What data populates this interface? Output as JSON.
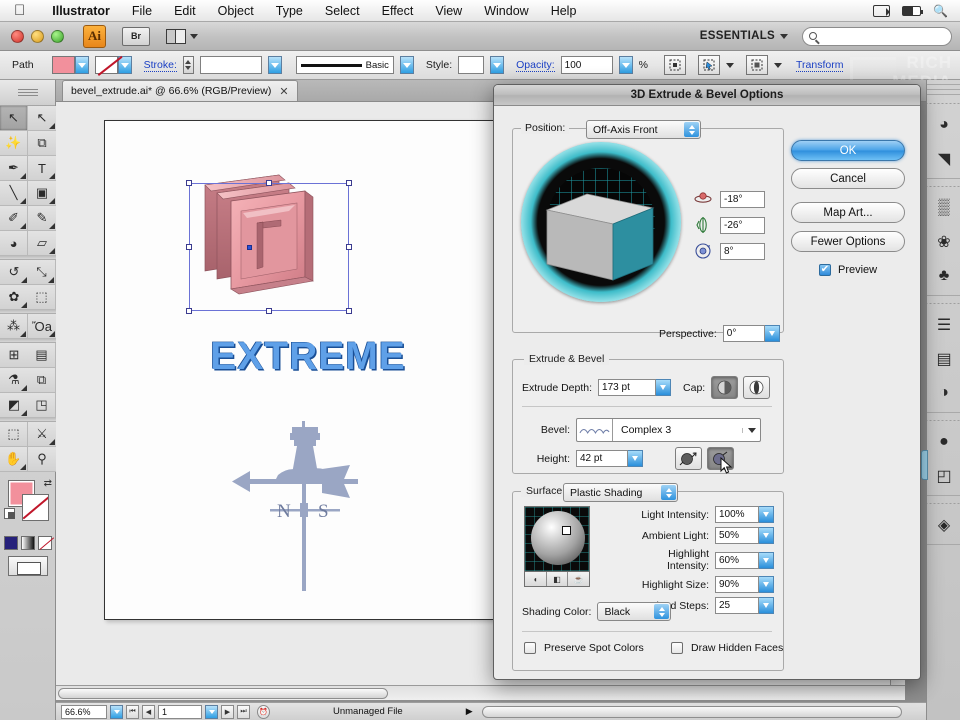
{
  "macmenu": {
    "apple": "apple-logo",
    "items": [
      "Illustrator",
      "File",
      "Edit",
      "Object",
      "Type",
      "Select",
      "Effect",
      "View",
      "Window",
      "Help"
    ]
  },
  "appbar": {
    "ai_badge": "Ai",
    "bridge_label": "Br",
    "workspace": "ESSENTIALS",
    "search_placeholder": ""
  },
  "controlbar": {
    "object_label": "Path",
    "stroke_label": "Stroke:",
    "stroke_weight": "",
    "brush_name": "Basic",
    "style_label": "Style:",
    "opacity_label": "Opacity:",
    "opacity_value": "100",
    "percent": "%",
    "transform_label": "Transform"
  },
  "document": {
    "tab_title": "bevel_extrude.ai* @ 66.6% (RGB/Preview)",
    "close_glyph": "✕"
  },
  "artwork": {
    "wordmark": "EXTREME",
    "vane_north": "N",
    "vane_south": "S",
    "fill_color": "#f2909c",
    "wordmark_color": "#5fa0e8"
  },
  "statusbar": {
    "zoom": "66.6%",
    "page": "1",
    "status_text": "Unmanaged File"
  },
  "watermark": {
    "line1": "RICH",
    "line2": "MEDIA",
    "line3": "INSTITUTE"
  },
  "tools": [
    {
      "name": "selection-tool",
      "glyph": "↖",
      "selected": true,
      "has_flyout": false
    },
    {
      "name": "direct-selection-tool",
      "glyph": "↖",
      "selected": false,
      "has_flyout": true
    },
    {
      "name": "magic-wand-tool",
      "glyph": "✨",
      "selected": false,
      "has_flyout": false
    },
    {
      "name": "lasso-tool",
      "glyph": "⧉",
      "selected": false,
      "has_flyout": false
    },
    {
      "name": "pen-tool",
      "glyph": "✒",
      "selected": false,
      "has_flyout": true
    },
    {
      "name": "type-tool",
      "glyph": "T",
      "selected": false,
      "has_flyout": true
    },
    {
      "name": "line-segment-tool",
      "glyph": "╲",
      "selected": false,
      "has_flyout": true
    },
    {
      "name": "rectangle-tool",
      "glyph": "▣",
      "selected": false,
      "has_flyout": true
    },
    {
      "name": "paintbrush-tool",
      "glyph": "✐",
      "selected": false,
      "has_flyout": true
    },
    {
      "name": "pencil-tool",
      "glyph": "✎",
      "selected": false,
      "has_flyout": true
    },
    {
      "name": "blob-brush-tool",
      "glyph": "◕",
      "selected": false,
      "has_flyout": false
    },
    {
      "name": "eraser-tool",
      "glyph": "▱",
      "selected": false,
      "has_flyout": true
    },
    {
      "name": "rotate-tool",
      "glyph": "↺",
      "selected": false,
      "has_flyout": true
    },
    {
      "name": "scale-tool",
      "glyph": "⤡",
      "selected": false,
      "has_flyout": true
    },
    {
      "name": "warp-tool",
      "glyph": "✿",
      "selected": false,
      "has_flyout": true
    },
    {
      "name": "free-transform-tool",
      "glyph": "⬚",
      "selected": false,
      "has_flyout": false
    },
    {
      "name": "symbol-sprayer-tool",
      "glyph": "⁂",
      "selected": false,
      "has_flyout": true
    },
    {
      "name": "column-graph-tool",
      "glyph": "Ὄa",
      "selected": false,
      "has_flyout": true
    },
    {
      "name": "mesh-tool",
      "glyph": "⊞",
      "selected": false,
      "has_flyout": false
    },
    {
      "name": "gradient-tool",
      "glyph": "▤",
      "selected": false,
      "has_flyout": false
    },
    {
      "name": "eyedropper-tool",
      "glyph": "⚗",
      "selected": false,
      "has_flyout": true
    },
    {
      "name": "blend-tool",
      "glyph": "⧉",
      "selected": false,
      "has_flyout": false
    },
    {
      "name": "live-paint-bucket-tool",
      "glyph": "◩",
      "selected": false,
      "has_flyout": true
    },
    {
      "name": "live-paint-selection-tool",
      "glyph": "◳",
      "selected": false,
      "has_flyout": false
    },
    {
      "name": "artboard-tool",
      "glyph": "⬚",
      "selected": false,
      "has_flyout": false
    },
    {
      "name": "slice-tool",
      "glyph": "⚔",
      "selected": false,
      "has_flyout": true
    },
    {
      "name": "hand-tool",
      "glyph": "✋",
      "selected": false,
      "has_flyout": true
    },
    {
      "name": "zoom-tool",
      "glyph": "⚲",
      "selected": false,
      "has_flyout": false
    }
  ],
  "right_dock": [
    {
      "name": "color-panel-icon",
      "glyph": "◕"
    },
    {
      "name": "color-guide-panel-icon",
      "glyph": "◥"
    },
    {
      "name": "swatches-panel-icon",
      "glyph": "▒"
    },
    {
      "name": "brushes-panel-icon",
      "glyph": "❀"
    },
    {
      "name": "symbols-panel-icon",
      "glyph": "♣"
    },
    {
      "name": "stroke-panel-icon",
      "glyph": "☰"
    },
    {
      "name": "gradient-panel-icon",
      "glyph": "▤"
    },
    {
      "name": "transparency-panel-icon",
      "glyph": "◑"
    },
    {
      "name": "appearance-panel-icon",
      "glyph": "●"
    },
    {
      "name": "graphic-styles-panel-icon",
      "glyph": "◰"
    },
    {
      "name": "layers-panel-icon",
      "glyph": "◈"
    }
  ],
  "dialog": {
    "title": "3D Extrude & Bevel Options",
    "buttons": {
      "ok": "OK",
      "cancel": "Cancel",
      "map_art": "Map Art...",
      "fewer_options": "Fewer Options"
    },
    "preview": {
      "label": "Preview",
      "checked": true,
      "check_glyph": "✔"
    },
    "position": {
      "label": "Position:",
      "value": "Off-Axis Front",
      "rotate_x_label": "rotate-x-axis-icon",
      "rotate_x": "-18°",
      "rotate_y_label": "rotate-y-axis-icon",
      "rotate_y": "-26°",
      "rotate_z_label": "rotate-z-axis-icon",
      "rotate_z": "8°",
      "perspective_label": "Perspective:",
      "perspective": "0°"
    },
    "extrude_bevel": {
      "legend": "Extrude & Bevel",
      "depth_label": "Extrude Depth:",
      "depth_value": "173 pt",
      "cap_label": "Cap:",
      "cap_on_selected": true,
      "bevel_label": "Bevel:",
      "bevel_value": "Complex 3",
      "height_label": "Height:",
      "height_value": "42 pt",
      "bevel_extent_out": "bevel-extent-out-icon",
      "bevel_extent_in": "bevel-extent-in-icon"
    },
    "surface": {
      "legend": "Surface:",
      "shading_value": "Plastic Shading",
      "fields": [
        {
          "label": "Light Intensity:",
          "value": "100%"
        },
        {
          "label": "Ambient Light:",
          "value": "50%"
        },
        {
          "label": "Highlight Intensity:",
          "value": "60%"
        },
        {
          "label": "Highlight Size:",
          "value": "90%"
        },
        {
          "label": "Blend Steps:",
          "value": "25"
        }
      ],
      "shading_color_label": "Shading Color:",
      "shading_color_value": "Black",
      "light_buttons": [
        {
          "name": "new-light-button",
          "glyph": "◔"
        },
        {
          "name": "move-light-back-button",
          "glyph": "◱"
        },
        {
          "name": "delete-light-button",
          "glyph": "Ὕ1"
        }
      ],
      "preserve_spot_label": "Preserve Spot Colors",
      "preserve_spot_checked": false,
      "draw_hidden_label": "Draw Hidden Faces",
      "draw_hidden_checked": false
    }
  }
}
